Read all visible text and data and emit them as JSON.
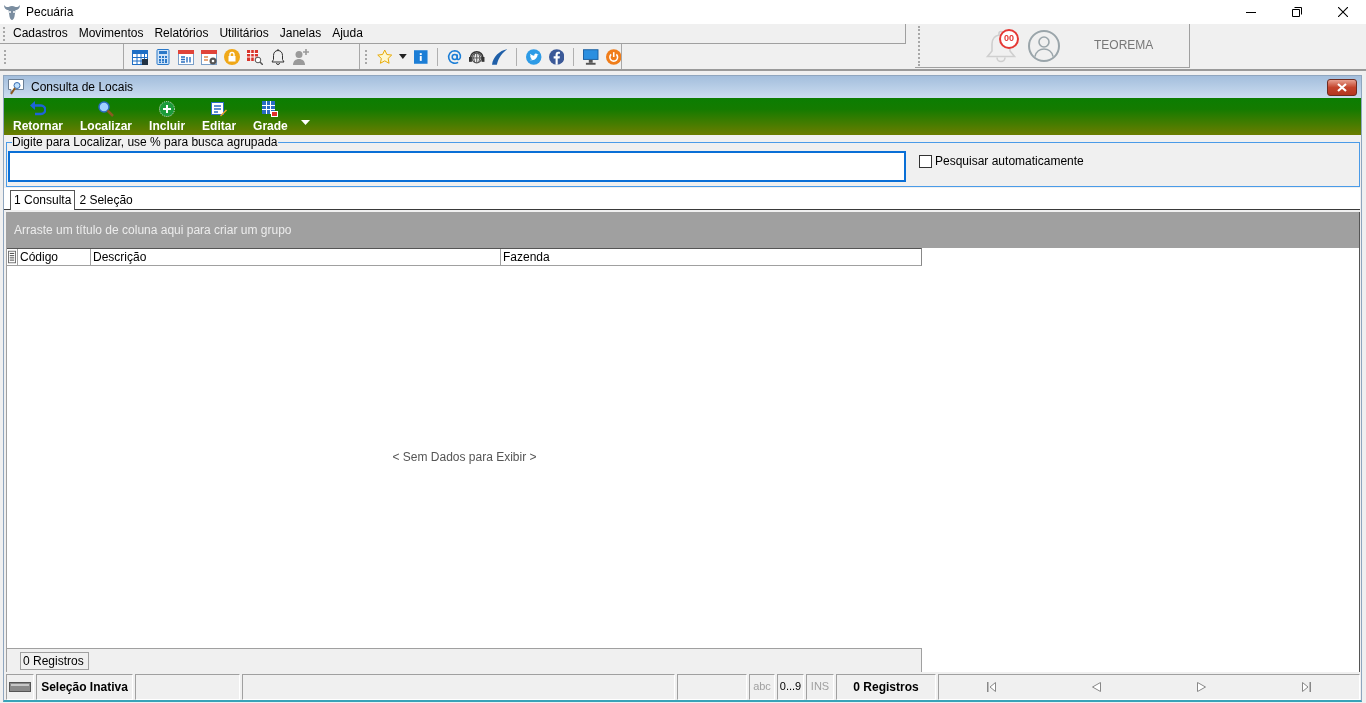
{
  "window": {
    "title": "Pecuária"
  },
  "menu": [
    "Cadastros",
    "Movimentos",
    "Relatórios",
    "Utilitários",
    "Janelas",
    "Ajuda"
  ],
  "user_panel": {
    "notification_count": "00",
    "user_name": "TEOREMA"
  },
  "child_window": {
    "title": "Consulta de Locais",
    "toolbar": [
      {
        "label": "Retornar",
        "kind": "return"
      },
      {
        "label": "Localizar",
        "kind": "find"
      },
      {
        "label": "Incluir",
        "kind": "add"
      },
      {
        "label": "Editar",
        "kind": "edit"
      },
      {
        "label": "Grade",
        "kind": "grid"
      }
    ],
    "search": {
      "legend": "Digite para Localizar, use % para busca agrupada",
      "auto_search": {
        "label": "Pesquisar automaticamente",
        "checked": false
      }
    },
    "tabs": [
      {
        "label": "1 Consulta",
        "selected": true
      },
      {
        "label": "2 Seleção",
        "selected": false
      }
    ],
    "grid": {
      "group_panel_hint": "Arraste um título de coluna aqui para criar um grupo",
      "columns": [
        "Código",
        "Descrição",
        "Fazenda"
      ],
      "empty_message": "< Sem Dados para Exibir >",
      "footer_count": "0 Registros"
    },
    "status_bar": {
      "selection": "Seleção Inativa",
      "indicators": [
        {
          "label": "abc",
          "disabled": true
        },
        {
          "label": "0...9",
          "disabled": false
        },
        {
          "label": "INS",
          "disabled": true
        }
      ],
      "records": "0 Registros"
    }
  }
}
